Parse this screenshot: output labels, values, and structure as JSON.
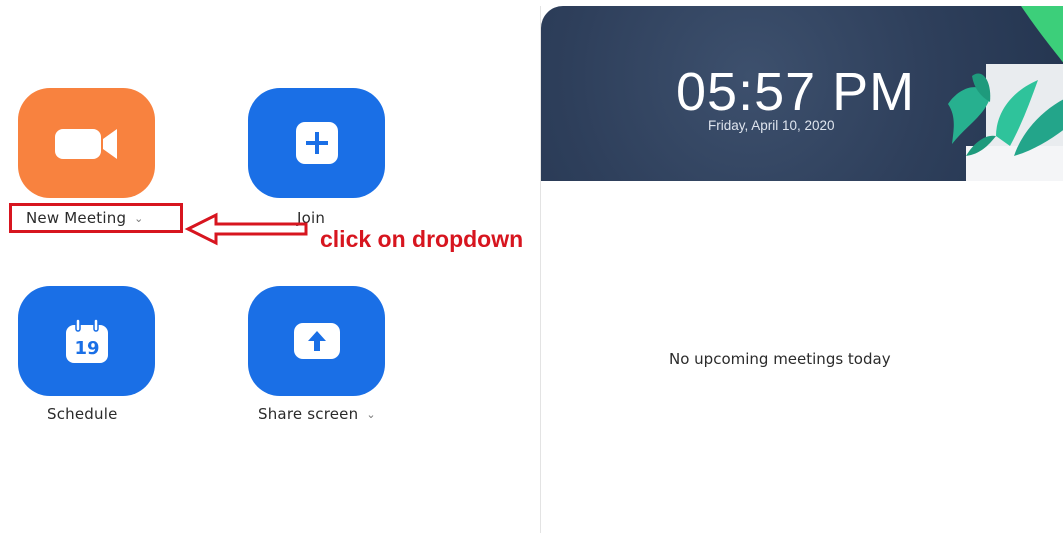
{
  "actions": {
    "new_meeting": {
      "label": "New Meeting",
      "icon": "video-camera-icon"
    },
    "join": {
      "label": "Join",
      "icon": "plus-icon"
    },
    "schedule": {
      "label": "Schedule",
      "icon": "calendar-icon",
      "calendar_day": "19"
    },
    "share_screen": {
      "label": "Share screen",
      "icon": "upload-arrow-icon"
    },
    "dropdown_caret": "⌄"
  },
  "annotation": {
    "text": "click on dropdown",
    "color": "#d7151f"
  },
  "header": {
    "time": "05:57 PM",
    "date": "Friday, April 10, 2020"
  },
  "meetings": {
    "empty_text": "No upcoming meetings today"
  },
  "colors": {
    "orange": "#f8823f",
    "blue": "#1a6fe6",
    "header_bg": "#2e3f5b"
  }
}
